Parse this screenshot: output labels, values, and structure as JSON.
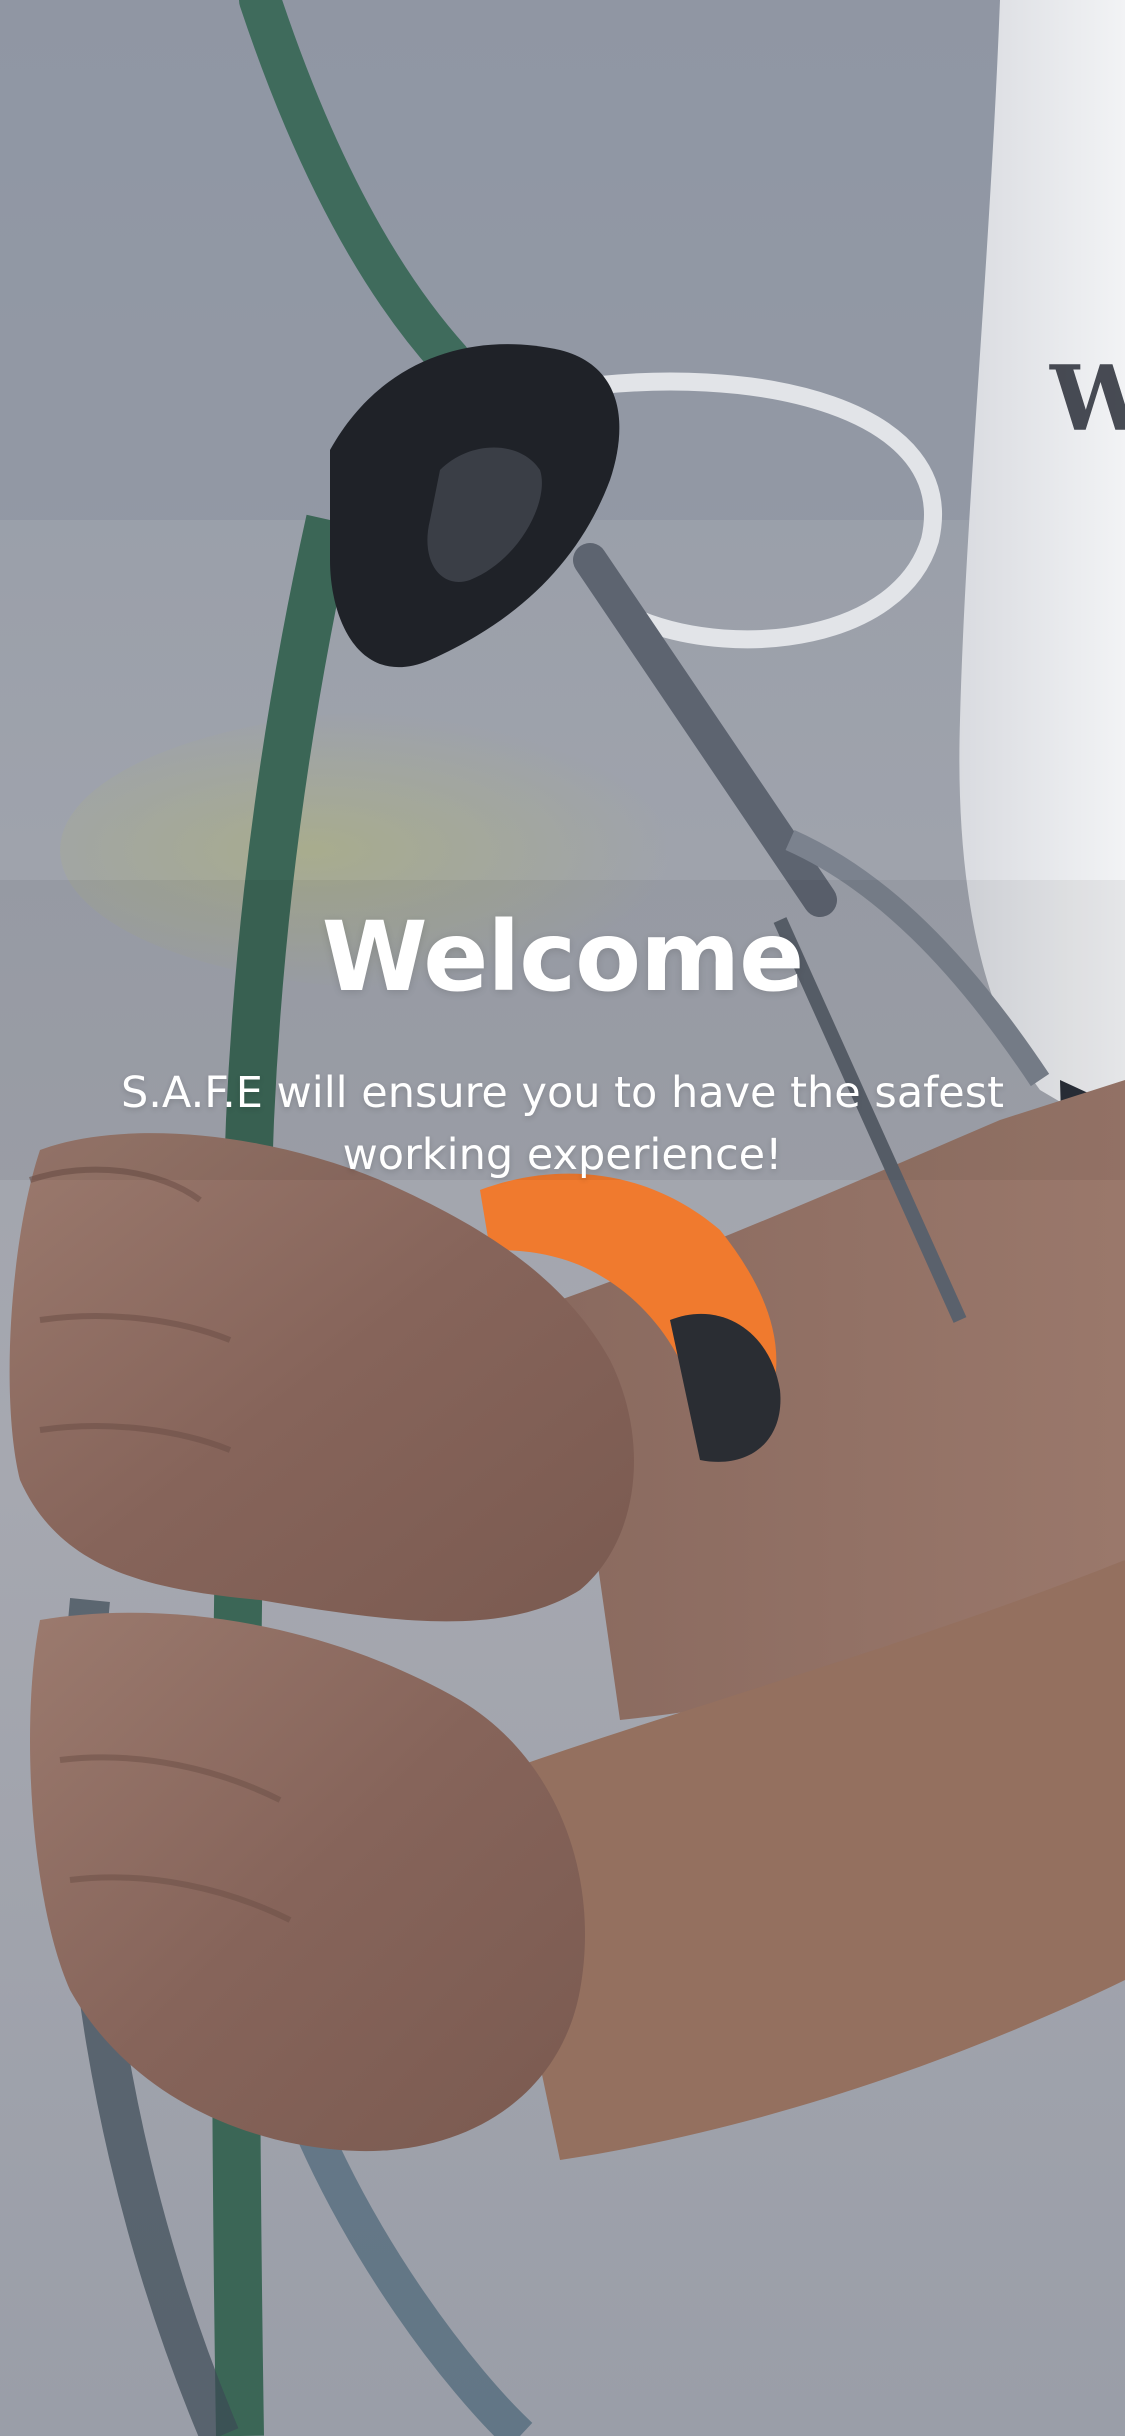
{
  "welcome": {
    "title": "Welcome",
    "subtitle": "S.A.F.E will ensure you to have the safest working experience!"
  },
  "background": {
    "description_icon": "climbing-rope-hands-photo",
    "colors": {
      "backdrop": "#9aa0aa",
      "rope": "#3f6b5c",
      "strap": "#f07a2e",
      "skin": "#8a6558",
      "device": "#1f2228",
      "shirt": "#e8e9ec",
      "text": "#ffffff"
    }
  }
}
